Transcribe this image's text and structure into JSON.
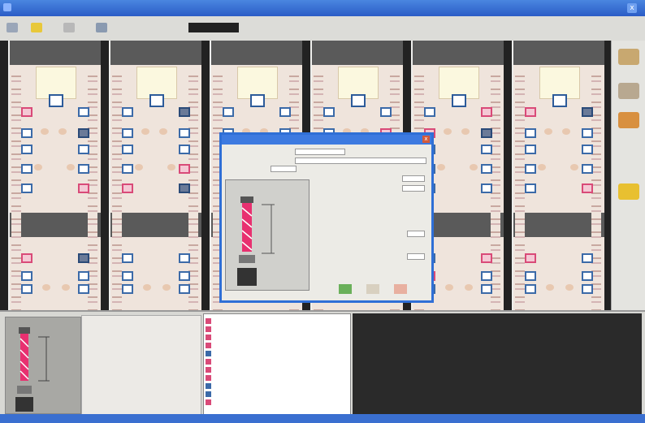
{
  "window": {
    "title": "",
    "close_label": "x"
  },
  "toolbar": {
    "field_label": "",
    "field_value": ""
  },
  "colors": {
    "title_bar": "#2a5cc6",
    "pin_blue": "#3b6aa8",
    "pin_pink": "#d94a78",
    "dialog_border": "#2f6fd6"
  },
  "right_panel": {
    "icons": [
      "chip-icon",
      "connector-icon",
      "module-icon",
      "folder-icon"
    ]
  },
  "dialog": {
    "title": "",
    "close_label": "x",
    "fields": [
      "",
      "",
      "",
      "",
      "",
      "",
      ""
    ],
    "buttons": [
      "ok-check-icon",
      "info-icon",
      "cancel-icon"
    ]
  },
  "bottom": {
    "list_rows": [
      "",
      "",
      "",
      "",
      "",
      "",
      "",
      "",
      "",
      "",
      ""
    ]
  }
}
